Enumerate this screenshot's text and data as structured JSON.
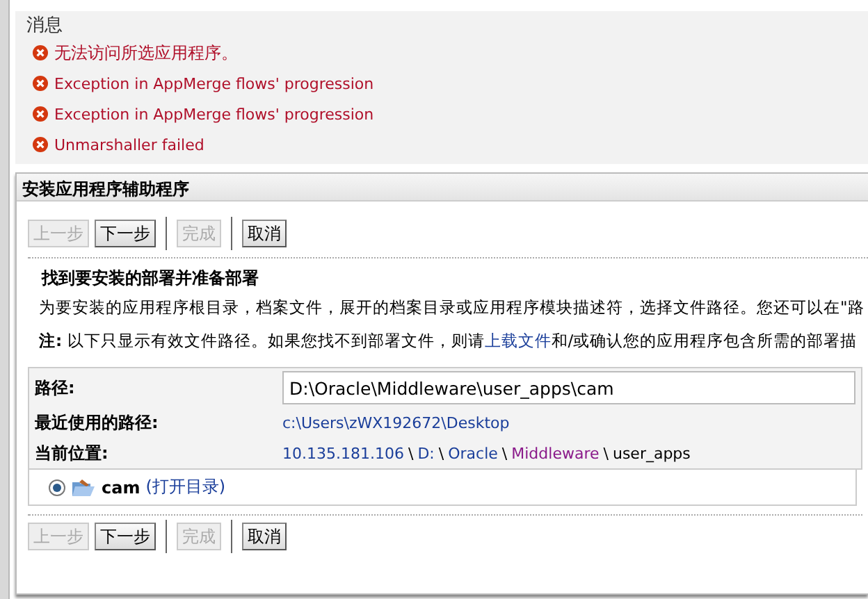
{
  "messages": {
    "title": "消息",
    "items": [
      {
        "text": "无法访问所选应用程序。",
        "kind": "error"
      },
      {
        "text": "Exception in AppMerge flows' progression",
        "kind": "error"
      },
      {
        "text": "Exception in AppMerge flows' progression",
        "kind": "error"
      },
      {
        "text": "Unmarshaller failed",
        "kind": "error"
      }
    ]
  },
  "wizard": {
    "title": "安装应用程序辅助程序",
    "top_buttons": [
      {
        "label": "上一步",
        "disabled": true
      },
      {
        "label": "下一步",
        "disabled": false
      },
      {
        "label": "完成",
        "disabled": true
      },
      {
        "label": "取消",
        "disabled": false
      }
    ],
    "heading": "找到要安装的部署并准备部署",
    "description": "为要安装的应用程序根目录，档案文件，展开的档案目录或应用程序模块描述符，选择文件路径。您还可以在\"路",
    "note": {
      "label": "注:",
      "before": " 以下只显示有效文件路径。如果您找不到部署文件，则请",
      "link": "上载文件",
      "after": "和/或确认您的应用程序包含所需的部署描"
    },
    "path": {
      "label": "路径:",
      "value": "D:\\Oracle\\Middleware\\user_apps\\cam"
    },
    "recent": {
      "label": "最近使用的路径:",
      "value": "c:\\Users\\zWX192672\\Desktop"
    },
    "location": {
      "label": "当前位置:",
      "parts": [
        {
          "text": "10.135.181.106",
          "kind": "link"
        },
        {
          "text": "\\",
          "kind": "sep"
        },
        {
          "text": "D:",
          "kind": "link"
        },
        {
          "text": "\\",
          "kind": "sep"
        },
        {
          "text": "Oracle",
          "kind": "link"
        },
        {
          "text": "\\",
          "kind": "sep"
        },
        {
          "text": "Middleware",
          "kind": "visited"
        },
        {
          "text": "\\",
          "kind": "sep"
        },
        {
          "text": "user_apps",
          "kind": "plain"
        }
      ]
    },
    "entries": [
      {
        "name": "cam",
        "action": "(打开目录)",
        "selected": true
      }
    ],
    "bottom_buttons": [
      {
        "label": "上一步",
        "disabled": true
      },
      {
        "label": "下一步",
        "disabled": false
      },
      {
        "label": "完成",
        "disabled": true
      },
      {
        "label": "取消",
        "disabled": false
      }
    ]
  }
}
